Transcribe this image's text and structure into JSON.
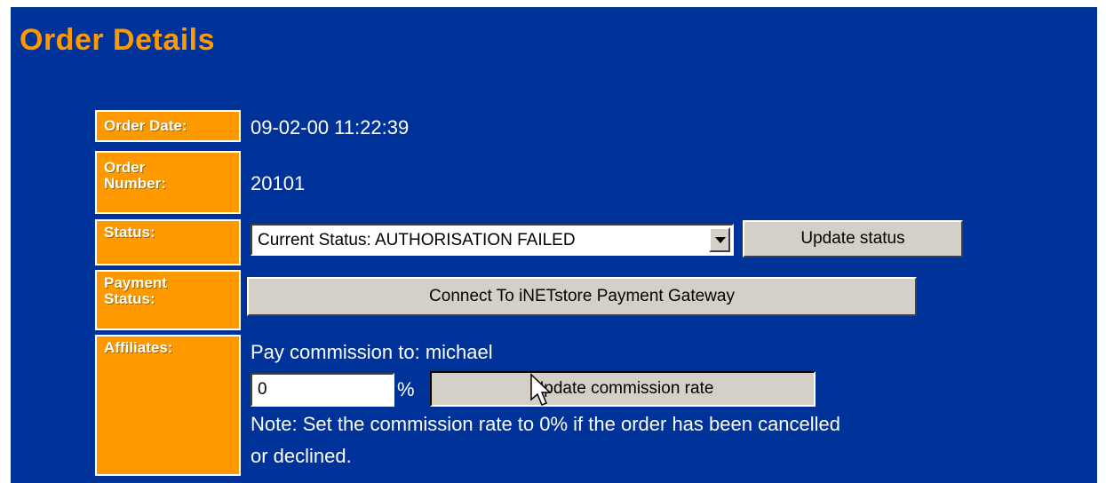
{
  "page": {
    "title": "Order Details"
  },
  "order_date": {
    "label": "Order Date:",
    "value": "09-02-00 11:22:39"
  },
  "order_number": {
    "label_line1": "Order",
    "label_line2": "Number:",
    "value": "20101"
  },
  "status": {
    "label": "Status:",
    "selected_option": "Current Status: AUTHORISATION FAILED",
    "update_button": "Update status"
  },
  "payment_status": {
    "label_line1": "Payment",
    "label_line2": "Status:",
    "gateway_button": "Connect To iNETstore Payment Gateway"
  },
  "affiliates": {
    "label": "Affiliates:",
    "commission_text": "Pay commission to: michael",
    "rate_value": "0",
    "percent_sign": "%",
    "update_button": "Update commission rate",
    "note_line1": "Note: Set the commission rate to 0% if the order has been cancelled",
    "note_line2": "or declined."
  },
  "colors": {
    "background": "#003399",
    "accent": "#ff9900",
    "button": "#d4d0c8"
  },
  "icons": {
    "cursor": "mouse-pointer-icon",
    "dropdown": "chevron-down-icon"
  }
}
